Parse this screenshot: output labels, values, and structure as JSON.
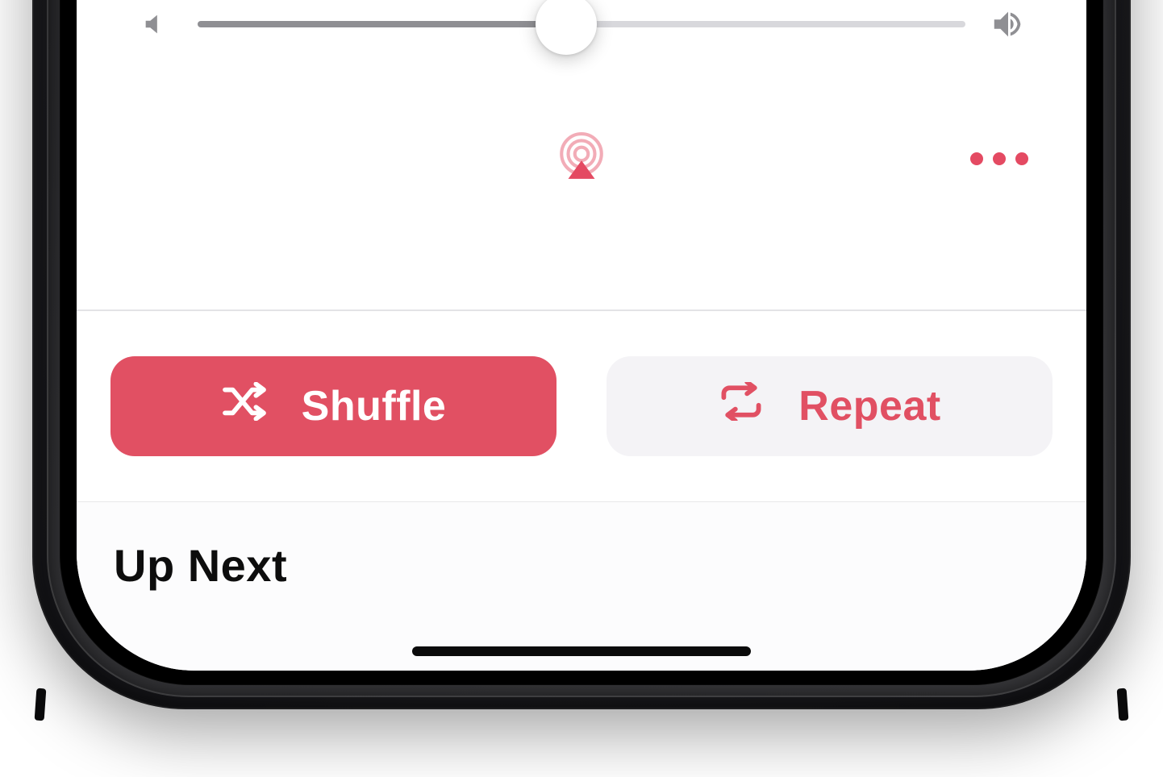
{
  "volume": {
    "percent": 48
  },
  "controls": {
    "airplay_label": "AirPlay",
    "more_label": "More"
  },
  "buttons": {
    "shuffle_label": "Shuffle",
    "repeat_label": "Repeat"
  },
  "up_next": {
    "title": "Up Next"
  },
  "colors": {
    "accent": "#e15063",
    "accent_alt": "#e44a62",
    "icon_gray": "#8f8f93",
    "track_gray": "#d8d8dc",
    "secondary_bg": "#f4f3f6"
  }
}
